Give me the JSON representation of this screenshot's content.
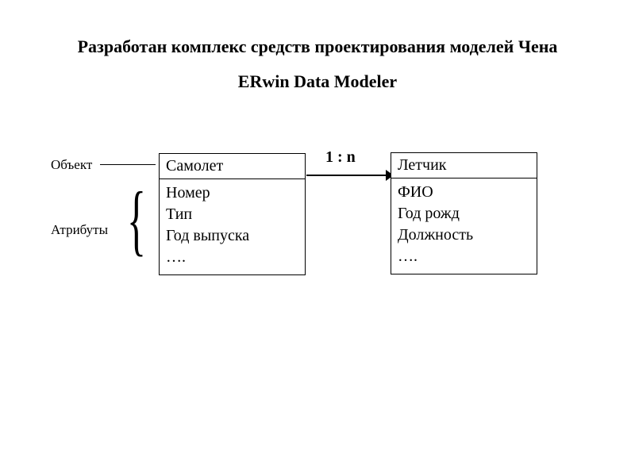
{
  "title": "Разработан комплекс средств проектирования моделей Чена",
  "subtitle": "ERwin  Data Modeler",
  "labels": {
    "object": "Объект",
    "attributes": "Атрибуты"
  },
  "relationship": "1 : n",
  "entity_left": {
    "name": "Самолет",
    "attrs": [
      "Номер",
      "Тип",
      "Год выпуска",
      "…."
    ]
  },
  "entity_right": {
    "name": "Летчик",
    "attrs": [
      "ФИО",
      "Год рожд",
      "Должность",
      "…."
    ]
  }
}
